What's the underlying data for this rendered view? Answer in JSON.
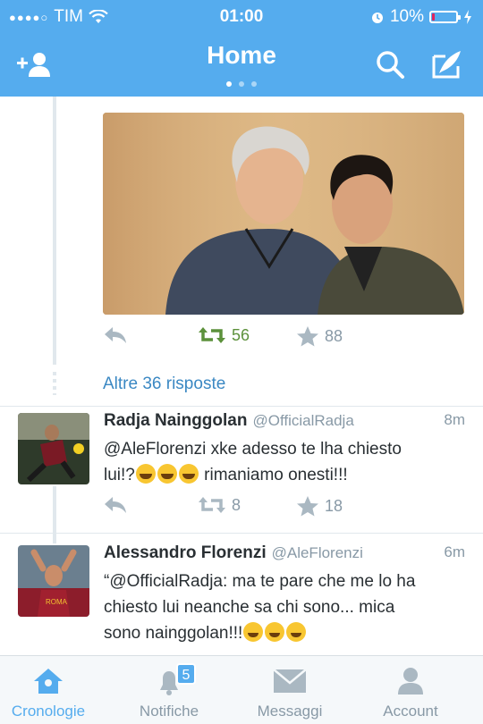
{
  "status_bar": {
    "carrier": "TIM",
    "time": "01:00",
    "battery": "10%",
    "battery_level": 0.1
  },
  "nav": {
    "title": "Home"
  },
  "tweet_top": {
    "retweets": "56",
    "favorites": "88"
  },
  "more_replies": "Altre 36 risposte",
  "tweets": [
    {
      "name": "Radja Nainggolan",
      "handle": "@OfficialRadja",
      "time": "8m",
      "text_1": "@AleFlorenzi xke adesso te lha chiesto",
      "text_2a": "lui!?",
      "text_2b": "rimaniamo onesti!!!",
      "retweets": "8",
      "favorites": "18"
    },
    {
      "name": "Alessandro Florenzi",
      "handle": "@AleFlorenzi",
      "time": "6m",
      "text_1": "“@OfficialRadja: ma te pare che me lo ha",
      "text_2": "chiesto lui neanche sa chi sono... mica",
      "text_3": "sono nainggolan!!!"
    }
  ],
  "tabs": [
    {
      "label": "Cronologie",
      "icon": "home-icon"
    },
    {
      "label": "Notifiche",
      "icon": "bell-icon",
      "badge": "5"
    },
    {
      "label": "Messaggi",
      "icon": "envelope-icon"
    },
    {
      "label": "Account",
      "icon": "person-icon"
    }
  ],
  "colors": {
    "brand": "#55acee",
    "retweet_active": "#5c913b",
    "link": "#3b88c3",
    "muted": "#8899a6"
  }
}
